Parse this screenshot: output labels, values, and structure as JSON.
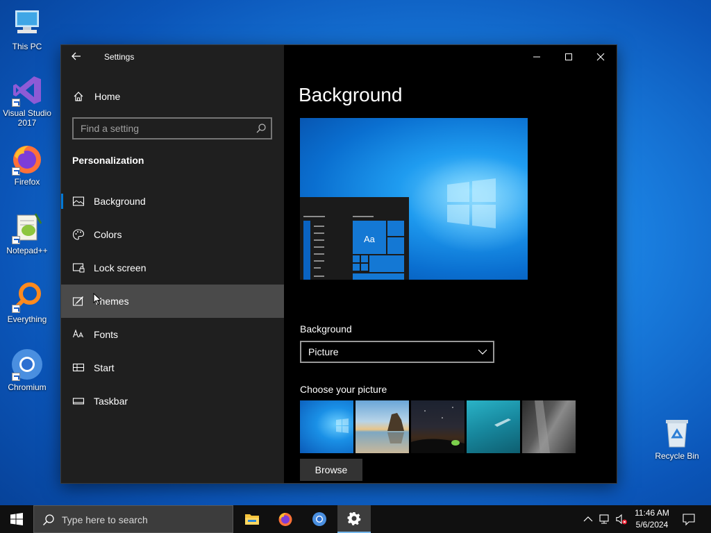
{
  "desktop": {
    "icons": [
      {
        "label": "This PC"
      },
      {
        "label": "Visual Studio 2017"
      },
      {
        "label": "Firefox"
      },
      {
        "label": "Notepad++"
      },
      {
        "label": "Everything"
      },
      {
        "label": "Chromium"
      },
      {
        "label": "Recycle Bin"
      }
    ]
  },
  "window": {
    "title": "Settings",
    "sidebar": {
      "home_label": "Home",
      "search_placeholder": "Find a setting",
      "section_title": "Personalization",
      "items": [
        {
          "label": "Background",
          "icon": "picture-icon",
          "active": true
        },
        {
          "label": "Colors",
          "icon": "palette-icon"
        },
        {
          "label": "Lock screen",
          "icon": "lock-screen-icon"
        },
        {
          "label": "Themes",
          "icon": "themes-icon",
          "hovered": true
        },
        {
          "label": "Fonts",
          "icon": "fonts-icon"
        },
        {
          "label": "Start",
          "icon": "start-icon"
        },
        {
          "label": "Taskbar",
          "icon": "taskbar-icon"
        }
      ]
    },
    "content": {
      "page_title": "Background",
      "preview_tile_text": "Aa",
      "background_label": "Background",
      "background_value": "Picture",
      "choose_picture_label": "Choose your picture",
      "browse_label": "Browse"
    }
  },
  "taskbar": {
    "search_placeholder": "Type here to search",
    "time": "11:46 AM",
    "date": "5/6/2024"
  },
  "colors": {
    "accent": "#0078d7",
    "sidebar_bg": "#1f1f1f",
    "hover_bg": "#4a4a4a"
  }
}
